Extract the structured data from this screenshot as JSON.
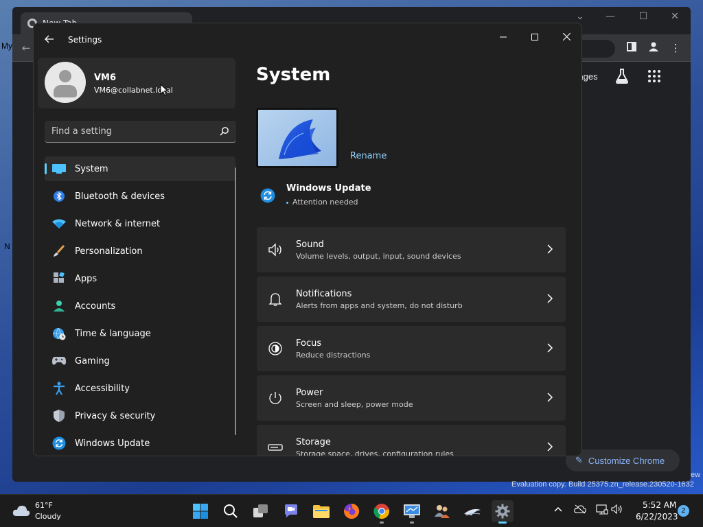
{
  "desktop": {
    "labels": [
      "My",
      "N"
    ],
    "evaluation": "Evaluation copy. Build 25375.zn_release.230520-1632",
    "evaluation_tail": "ew"
  },
  "chrome": {
    "tab_title": "New Tab",
    "images_label": "Images",
    "customize_label": "Customize Chrome"
  },
  "settings": {
    "window_title": "Settings",
    "user": {
      "name": "VM6",
      "email": "VM6@collabnet.local"
    },
    "search_placeholder": "Find a setting",
    "nav": [
      {
        "label": "System",
        "icon": "system-display-icon",
        "active": true
      },
      {
        "label": "Bluetooth & devices",
        "icon": "bluetooth-icon"
      },
      {
        "label": "Network & internet",
        "icon": "wifi-icon"
      },
      {
        "label": "Personalization",
        "icon": "brush-icon"
      },
      {
        "label": "Apps",
        "icon": "apps-icon"
      },
      {
        "label": "Accounts",
        "icon": "person-icon"
      },
      {
        "label": "Time & language",
        "icon": "globe-clock-icon"
      },
      {
        "label": "Gaming",
        "icon": "gamepad-icon"
      },
      {
        "label": "Accessibility",
        "icon": "accessibility-icon"
      },
      {
        "label": "Privacy & security",
        "icon": "shield-icon"
      },
      {
        "label": "Windows Update",
        "icon": "update-icon"
      }
    ],
    "page_title": "System",
    "rename_label": "Rename",
    "windows_update": {
      "title": "Windows Update",
      "status": "Attention needed"
    },
    "cards": [
      {
        "title": "Sound",
        "subtitle": "Volume levels, output, input, sound devices",
        "icon": "speaker-icon"
      },
      {
        "title": "Notifications",
        "subtitle": "Alerts from apps and system, do not disturb",
        "icon": "bell-icon"
      },
      {
        "title": "Focus",
        "subtitle": "Reduce distractions",
        "icon": "focus-icon"
      },
      {
        "title": "Power",
        "subtitle": "Screen and sleep, power mode",
        "icon": "power-icon"
      },
      {
        "title": "Storage",
        "subtitle": "Storage space, drives, configuration rules",
        "icon": "storage-icon"
      }
    ]
  },
  "taskbar": {
    "weather": {
      "temp": "61°F",
      "condition": "Cloudy"
    },
    "clock": {
      "time": "5:52 AM",
      "date": "6/22/2023"
    },
    "notification_count": "2"
  },
  "colors": {
    "accent": "#60cdff",
    "settings_bg": "#202020",
    "card_bg": "#2b2b2b",
    "taskbar_bg": "#1c1c1c"
  }
}
